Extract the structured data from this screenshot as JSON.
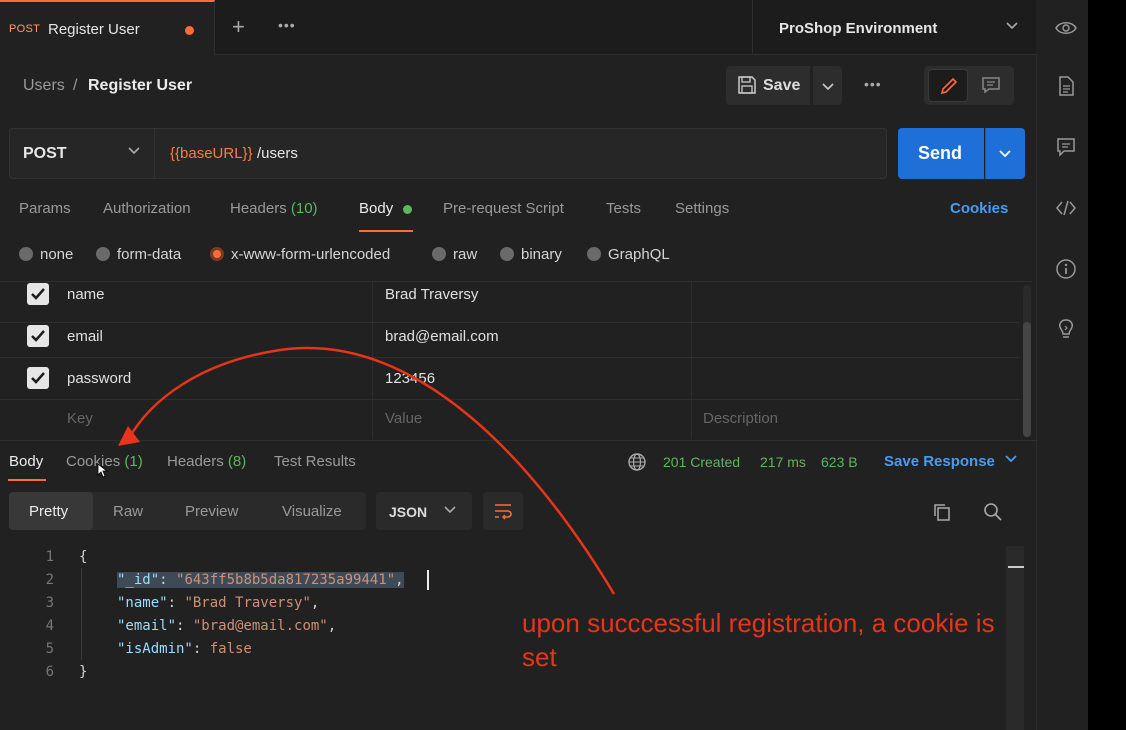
{
  "tab": {
    "method": "POST",
    "title": "Register User"
  },
  "environment": {
    "name": "ProShop Environment"
  },
  "breadcrumb": {
    "parent": "Users",
    "separator": "/",
    "current": "Register User"
  },
  "toolbar": {
    "save_label": "Save"
  },
  "request": {
    "method": "POST",
    "url_variable": "{{baseURL}}",
    "url_path": "/users",
    "send_label": "Send"
  },
  "request_tabs": {
    "params": "Params",
    "authorization": "Authorization",
    "headers": "Headers",
    "headers_count": "(10)",
    "body": "Body",
    "prerequest": "Pre-request Script",
    "tests": "Tests",
    "settings": "Settings",
    "cookies": "Cookies"
  },
  "body_types": [
    "none",
    "form-data",
    "x-www-form-urlencoded",
    "raw",
    "binary",
    "GraphQL"
  ],
  "body_type_selected": "x-www-form-urlencoded",
  "form_rows": [
    {
      "key": "name",
      "value": "Brad Traversy",
      "checked": true
    },
    {
      "key": "email",
      "value": "brad@email.com",
      "checked": true
    },
    {
      "key": "password",
      "value": "123456",
      "checked": true
    }
  ],
  "form_placeholders": {
    "key": "Key",
    "value": "Value",
    "description": "Description"
  },
  "response_tabs": {
    "body": "Body",
    "cookies": "Cookies",
    "cookies_count": "(1)",
    "headers": "Headers",
    "headers_count": "(8)",
    "test_results": "Test Results"
  },
  "response_meta": {
    "status": "201 Created",
    "time": "217 ms",
    "size": "623 B",
    "save_response": "Save Response"
  },
  "view_modes": [
    "Pretty",
    "Raw",
    "Preview",
    "Visualize"
  ],
  "format": "JSON",
  "code_lines": {
    "numbers": [
      "1",
      "2",
      "3",
      "4",
      "5",
      "6"
    ],
    "l1": "{",
    "l2_key": "\"_id\"",
    "l2_val": "\"643ff5b8b5da817235a99441\"",
    "l3_key": "\"name\"",
    "l3_val": "\"Brad Traversy\"",
    "l4_key": "\"email\"",
    "l4_val": "\"brad@email.com\"",
    "l5_key": "\"isAdmin\"",
    "l5_val": "false",
    "l6": "}"
  },
  "annotation": {
    "text": "upon succcessful registration, a cookie is set",
    "color": "#e8341b"
  },
  "colors": {
    "accent": "#ff6c37",
    "send": "#1f6fd8",
    "success": "#5bb85d",
    "link": "#4a9cf0"
  }
}
